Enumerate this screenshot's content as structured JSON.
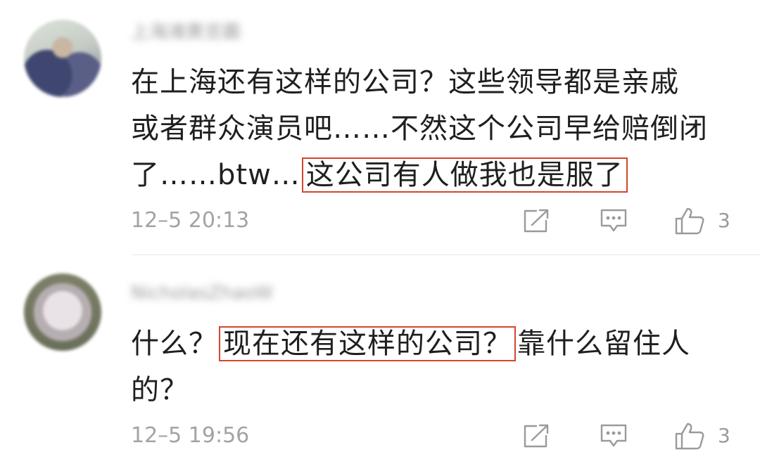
{
  "comments": [
    {
      "username": "上海滩黄览霸",
      "lines": [
        [
          {
            "text": "在上海还有这样的公司？这些领导都是亲戚"
          }
        ],
        [
          {
            "text": "或者群众演员吧……不然这个公司早给赔倒闭"
          }
        ],
        [
          {
            "text": "了……btw…"
          },
          {
            "text": "这公司有人做我也是服了",
            "highlight": true
          }
        ]
      ],
      "time": "12–5 20:13",
      "likes": "3"
    },
    {
      "username": "NicholasZhaoW",
      "lines": [
        [
          {
            "text": "什么？"
          },
          {
            "text": "现在还有这样的公司？",
            "highlight": true
          },
          {
            "text": "靠什么留住人"
          }
        ],
        [
          {
            "text": "的？"
          }
        ]
      ],
      "time": "12–5 19:56",
      "likes": "3"
    }
  ],
  "icons": {
    "share": "share-icon",
    "reply": "comment-reply-icon",
    "like": "thumbs-up-icon"
  },
  "colors": {
    "highlight_border": "#d2462e",
    "meta_text": "#a3a3a3",
    "icon_stroke": "#9a9a9a"
  }
}
